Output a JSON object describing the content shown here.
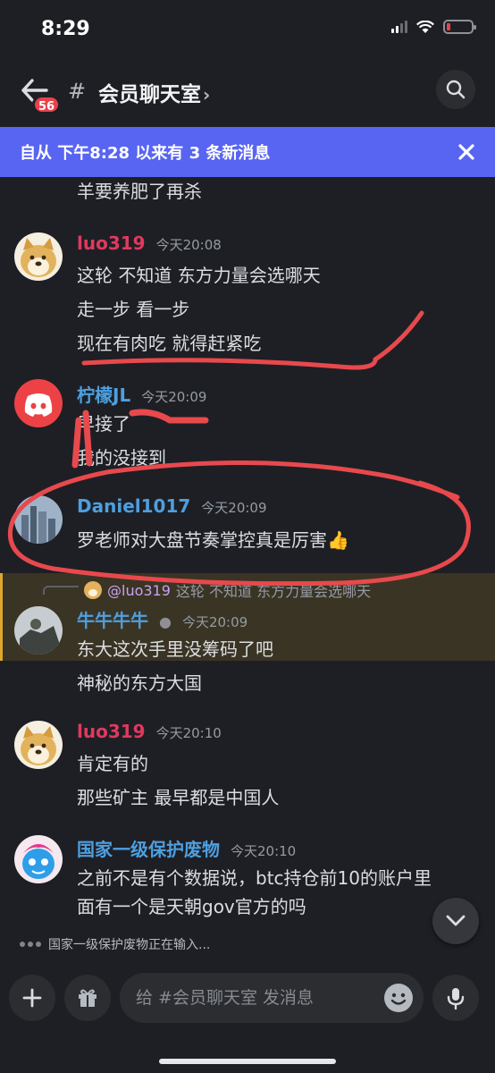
{
  "status_bar": {
    "time": "8:29"
  },
  "header": {
    "unread_badge": "56",
    "channel_name": "会员聊天室",
    "chevron": "›"
  },
  "banner": {
    "text": "自从 下午8:28 以来有 3 条新消息"
  },
  "messages": {
    "top_line": "羊要养肥了再杀",
    "m1": {
      "author": "luo319",
      "time": "今天20:08",
      "author_color": "#e0395f",
      "lines": [
        "这轮 不知道 东方力量会选哪天",
        "走一步 看一步",
        "现在有肉吃 就得赶紧吃"
      ]
    },
    "m2": {
      "author": "柠檬JL",
      "time": "今天20:09",
      "author_color": "#4e9fe0",
      "lines": [
        "早接了",
        "我的没接到"
      ]
    },
    "m3": {
      "author": "Daniel1017",
      "time": "今天20:09",
      "author_color": "#4e9fe0",
      "lines": [
        "罗老师对大盘节奏掌控真是厉害👍"
      ]
    },
    "m4": {
      "reply_mention": "@luo319",
      "reply_text": "这轮 不知道 东方力量会选哪天",
      "author": "牛牛牛牛",
      "time": "今天20:09",
      "author_color": "#4e9fe0",
      "lines": [
        "东大这次手里没筹码了吧",
        "神秘的东方大国"
      ]
    },
    "m5": {
      "author": "luo319",
      "time": "今天20:10",
      "author_color": "#e0395f",
      "lines": [
        "肯定有的",
        "那些矿主 最早都是中国人"
      ]
    },
    "m6": {
      "author": "国家一级保护废物",
      "time": "今天20:10",
      "author_color": "#4e9fe0",
      "lines": [
        "之前不是有个数据说，btc持仓前10的账户里",
        "面有一个是天朝gov官方的吗"
      ]
    }
  },
  "typing_indicator": "国家一级保护废物正在输入...",
  "composer": {
    "placeholder": "给 #会员聊天室 发消息"
  },
  "colors": {
    "accent": "#5865f2",
    "highlight_bar": "#e0a72d",
    "annotation_red": "#e8494d"
  }
}
